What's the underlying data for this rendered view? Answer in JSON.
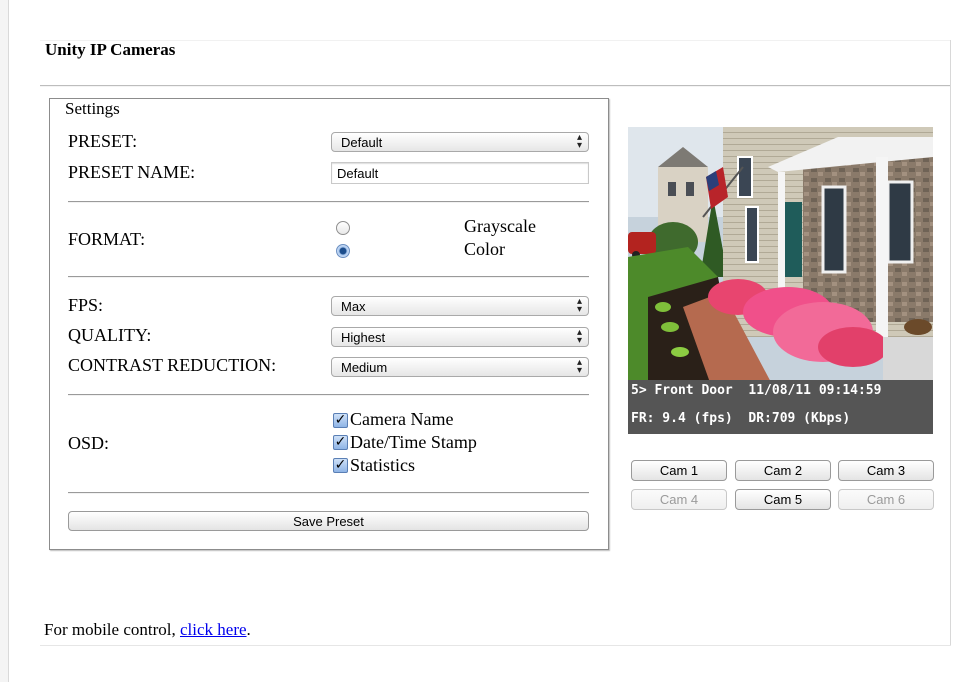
{
  "app": {
    "title": "Unity IP Cameras"
  },
  "settings": {
    "legend": "Settings",
    "preset": {
      "label": "PRESET:",
      "value": "Default"
    },
    "preset_name": {
      "label": "PRESET NAME:",
      "value": "Default"
    },
    "format": {
      "label": "FORMAT:",
      "options": [
        {
          "label": "Grayscale",
          "checked": false
        },
        {
          "label": "Color",
          "checked": true
        }
      ]
    },
    "fps": {
      "label": "FPS:",
      "value": "Max"
    },
    "quality": {
      "label": "QUALITY:",
      "value": "Highest"
    },
    "contrast": {
      "label": "CONTRAST REDUCTION:",
      "value": "Medium"
    },
    "osd": {
      "label": "OSD:",
      "options": [
        {
          "label": "Camera Name",
          "checked": true
        },
        {
          "label": "Date/Time Stamp",
          "checked": true
        },
        {
          "label": "Statistics",
          "checked": true
        }
      ]
    },
    "save_label": "Save Preset"
  },
  "camera": {
    "osd_line1": "5> Front Door  11/08/11 09:14:59",
    "osd_line2": "FR: 9.4 (fps)  DR:709 (Kbps)",
    "buttons": [
      {
        "label": "Cam 1",
        "enabled": true
      },
      {
        "label": "Cam 2",
        "enabled": true
      },
      {
        "label": "Cam 3",
        "enabled": true
      },
      {
        "label": "Cam 4",
        "enabled": false
      },
      {
        "label": "Cam 5",
        "enabled": true
      },
      {
        "label": "Cam 6",
        "enabled": false
      }
    ]
  },
  "footer": {
    "text": "For mobile control, ",
    "link": "click here",
    "suffix": "."
  }
}
